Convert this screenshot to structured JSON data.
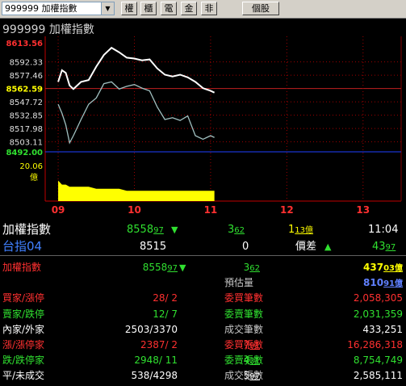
{
  "toolbar": {
    "symbol": "999999 加權指數",
    "buttons": [
      "權",
      "櫃",
      "電",
      "金",
      "非"
    ],
    "stock_button": "個股"
  },
  "chart_data": {
    "type": "line",
    "title": "999999 加權指數",
    "price_ticks": [
      "8613.56",
      "8592.33",
      "8577.46",
      "8562.59",
      "8547.72",
      "8532.85",
      "8517.98",
      "8503.11",
      "8492.00"
    ],
    "reference_price": "8562.59",
    "volume_tick": "20.06",
    "volume_unit": "億",
    "x_ticks": [
      "09",
      "10",
      "11",
      "12",
      "13"
    ],
    "ylim": [
      8492.0,
      8613.56
    ],
    "series": [
      {
        "x": [
          9.0,
          9.05,
          9.1,
          9.15,
          9.2,
          9.3,
          9.4,
          9.5,
          9.6,
          9.7,
          9.8,
          9.9,
          10.0,
          10.1,
          10.2,
          10.3,
          10.4,
          10.5,
          10.6,
          10.7,
          10.8,
          10.9,
          11.0,
          11.05
        ],
        "values": [
          8570,
          8583,
          8580,
          8566,
          8562,
          8570,
          8572,
          8587,
          8600,
          8608,
          8603,
          8597,
          8596,
          8594,
          8595,
          8585,
          8578,
          8576,
          8578,
          8575,
          8570,
          8563,
          8560,
          8558
        ]
      },
      {
        "x": [
          9.0,
          9.05,
          9.1,
          9.15,
          9.2,
          9.3,
          9.4,
          9.5,
          9.6,
          9.7,
          9.8,
          9.9,
          10.0,
          10.1,
          10.2,
          10.3,
          10.4,
          10.5,
          10.6,
          10.7,
          10.8,
          10.9,
          11.0,
          11.05
        ],
        "values": [
          8545,
          8535,
          8522,
          8502,
          8510,
          8528,
          8545,
          8552,
          8568,
          8570,
          8562,
          8565,
          8567,
          8563,
          8560,
          8542,
          8528,
          8530,
          8527,
          8532,
          8510,
          8506,
          8510,
          8508
        ]
      }
    ],
    "volume": [
      10,
      8,
      8,
      7,
      7,
      7,
      7,
      6,
      6,
      6,
      6,
      5,
      5,
      5,
      5,
      5,
      5,
      5,
      5,
      5,
      5,
      5,
      5,
      5
    ]
  },
  "summary": {
    "row1": {
      "name": "加權指數",
      "price": "8558",
      "price_dec": "97",
      "arrow": "▼",
      "chg": "3",
      "chg_dec": "62",
      "vol": "1",
      "vol_dec": "13億",
      "time": "11:04"
    },
    "row2": {
      "name": "台指04",
      "price": "8515",
      "chg": "0",
      "label": "價差",
      "arrow": "▲",
      "val": "43",
      "val_dec": "97"
    }
  },
  "detail": [
    {
      "l": "加權指數",
      "lc": "red",
      "a": "8558",
      "ad": "97",
      "arr": "▼",
      "b": "3",
      "bd": "62",
      "m": "",
      "r": "437",
      "rd": "03億",
      "rc": "yel"
    },
    {
      "l": "",
      "a": "",
      "ad": "",
      "b": "",
      "bd": "",
      "m": "預估量",
      "r": "810",
      "rd": "91億",
      "rc": "blu"
    },
    {
      "l": "買家/漲停",
      "lc": "red",
      "a": "28/  2",
      "b": "",
      "m": "委買筆數",
      "mc": "red",
      "r": "2,058,305",
      "rc": "red"
    },
    {
      "l": "賣家/跌停",
      "lc": "grn",
      "a": "12/  7",
      "b": "",
      "m": "委賣筆數",
      "mc": "grn",
      "r": "2,031,359",
      "rc": "grn"
    },
    {
      "l": "內家/外家",
      "lc": "wht",
      "a": "2503/3370",
      "b": "",
      "m": "成交筆數",
      "mc": "wht",
      "r": "433,251",
      "rc": "wht"
    },
    {
      "l": "漲/漲停家",
      "lc": "red",
      "a": "2387/  2",
      "b": "7",
      "bd": "91",
      "m": "委買張數",
      "mc": "red",
      "r": "16,286,318",
      "rc": "red"
    },
    {
      "l": "跌/跌停家",
      "lc": "grn",
      "a": "2948/ 11",
      "b": "4",
      "bd": "31",
      "m": "委賣張數",
      "mc": "grn",
      "r": "8,754,749",
      "rc": "grn"
    },
    {
      "l": "平/未成交",
      "lc": "wht",
      "a": "538/4298",
      "b": "5",
      "bd": "97",
      "m": "成交張數",
      "mc": "wht",
      "r": "2,585,111",
      "rc": "wht"
    }
  ]
}
